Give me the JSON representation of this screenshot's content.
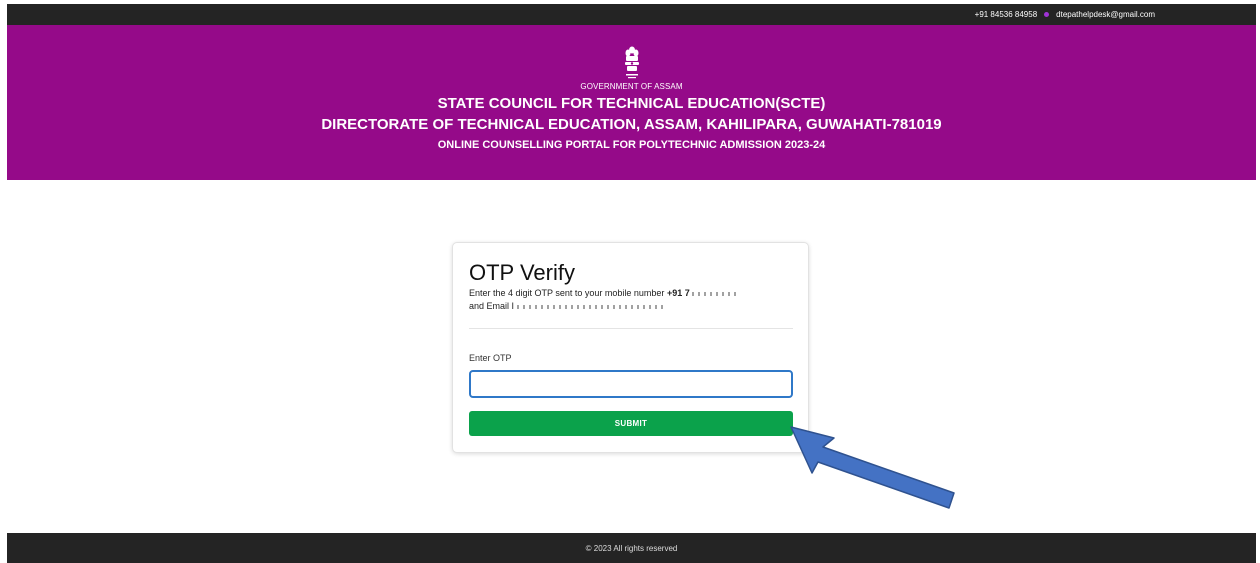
{
  "topbar": {
    "phone": "+91 84536 84958",
    "email": "dtepathelpdesk@gmail.com",
    "dot_color": "#a033d6"
  },
  "header": {
    "emblem_icon": "state-emblem-icon",
    "government": "GOVERNMENT OF ASSAM",
    "council": "STATE COUNCIL FOR TECHNICAL EDUCATION(SCTE)",
    "directorate": "DIRECTORATE OF TECHNICAL EDUCATION, ASSAM, KAHILIPARA, GUWAHATI-781019",
    "portal": "ONLINE COUNSELLING PORTAL FOR POLYTECHNIC ADMISSION 2023-24",
    "background_color": "#950a89"
  },
  "otp_card": {
    "title": "OTP Verify",
    "message_prefix": "Enter the 4 digit OTP sent to your mobile number",
    "mobile_visible": "+91 7",
    "email_prefix": "and Email",
    "email_visible": "I",
    "otp_label": "Enter OTP",
    "otp_value": "",
    "submit_label": "SUBMIT",
    "submit_color": "#0ba24b",
    "input_border_color": "#2f78c8"
  },
  "annotation": {
    "arrow_icon": "pointer-arrow-icon",
    "arrow_color": "#4472c4"
  },
  "footer": {
    "copyright": "© 2023 All rights reserved"
  }
}
